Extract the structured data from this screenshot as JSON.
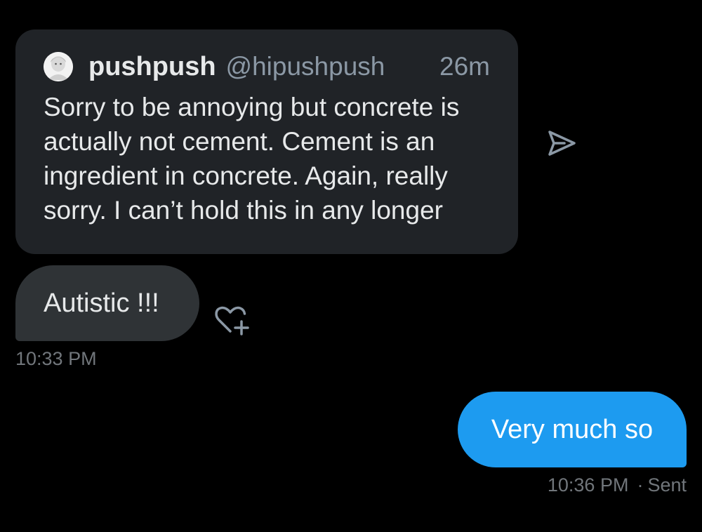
{
  "colors": {
    "background": "#000000",
    "quote_card_bg": "#202327",
    "received_bubble_bg": "#2f3336",
    "sent_bubble_bg": "#1d9bf0",
    "primary_text": "#e7e9ea",
    "secondary_text": "#8b98a5",
    "meta_text": "#71767b"
  },
  "quoted_post": {
    "avatar_icon": "user-avatar",
    "display_name": "pushpush",
    "handle": "@hipushpush",
    "time_ago": "26m",
    "text": "Sorry to be annoying but concrete is actually not cement. Cement is an ingredient in concrete. Again, really sorry. I can’t hold this in any longer",
    "share_icon": "send-icon"
  },
  "received_message": {
    "text": "Autistic !!!",
    "react_icon": "add-reaction-heart-icon",
    "timestamp": "10:33 PM"
  },
  "sent_message": {
    "text": "Very much so",
    "timestamp": "10:36 PM",
    "separator": "·",
    "status": "Sent"
  }
}
